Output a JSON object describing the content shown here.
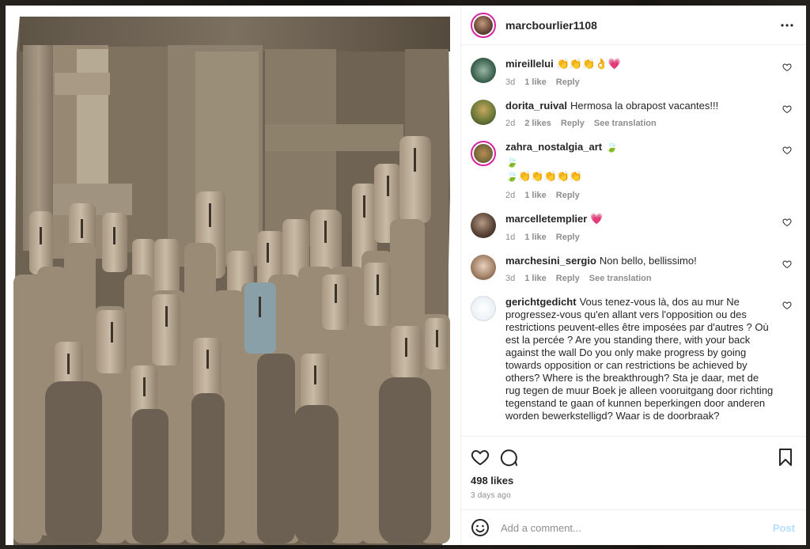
{
  "post": {
    "username": "marcbourlier1108",
    "likes": "498 likes",
    "date": "3 days ago"
  },
  "comments": [
    {
      "user": "mireillelui",
      "text": "👏👏👏👌💗",
      "time": "3d",
      "likes": "1 like",
      "reply": "Reply",
      "translate": ""
    },
    {
      "user": "dorita_ruival",
      "text": "Hermosa la obrapost vacantes!!!",
      "time": "2d",
      "likes": "2 likes",
      "reply": "Reply",
      "translate": "See translation"
    },
    {
      "user": "zahra_nostalgia_art",
      "text": "🍃\n🍃👏👏👏👏👏",
      "time": "2d",
      "likes": "1 like",
      "reply": "Reply",
      "translate": ""
    },
    {
      "user": "marcelletemplier",
      "text": "💗",
      "time": "1d",
      "likes": "1 like",
      "reply": "Reply",
      "translate": ""
    },
    {
      "user": "marchesini_sergio",
      "text": "Non bello, bellissimo!",
      "time": "3d",
      "likes": "1 like",
      "reply": "Reply",
      "translate": "See translation"
    },
    {
      "user": "gerichtgedicht",
      "text": "Vous tenez-vous là, dos au mur Ne progressez-vous qu'en allant vers l'opposition ou des restrictions peuvent-elles être imposées par d'autres ? Où est la percée ? Are you standing there, with your back against the wall Do you only make progress by going towards opposition or can restrictions be achieved by others? Where is the breakthrough? Sta je daar, met de rug tegen de muur Boek je alleen vooruitgang door richting tegenstand te gaan of kunnen beperkingen door anderen worden bewerkstelligd? Waar is de doorbraak?",
      "time": "",
      "likes": "",
      "reply": "",
      "translate": ""
    }
  ],
  "composer": {
    "placeholder": "Add a comment...",
    "post_label": "Post"
  },
  "colors": {
    "accent_disabled": "#b2dffc",
    "story_ring": "#d6249f",
    "secondary_text": "#8e8e8e"
  },
  "icons": [
    "more-icon",
    "heart-icon",
    "comment-icon",
    "save-icon",
    "emoji-icon"
  ]
}
